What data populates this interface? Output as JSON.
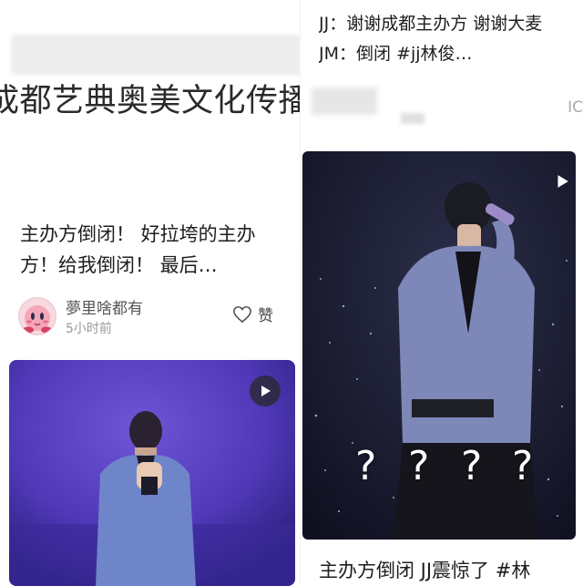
{
  "left_post": {
    "org_name": "成都艺典奥美文化传播",
    "title": "主办方倒闭！ 好拉垮的主办方！给我倒闭！ 最后…",
    "author": "夢里啥都有",
    "time": "5小时前",
    "like_label": "赞"
  },
  "right_post": {
    "top_text": "JJ：谢谢成都主办方 谢谢大麦 JM：倒闭 #jj林俊…",
    "edge_fragment": "IC",
    "question_marks": [
      "?",
      "?",
      "?",
      "?"
    ],
    "bottom_text": "主办方倒闭 JJ震惊了 #林"
  },
  "icons": {
    "play": "play-icon",
    "like": "heart-icon",
    "avatar": "kirby-avatar"
  },
  "colors": {
    "stage_purple": "#5b3fbf",
    "stage_dark": "#14162a"
  }
}
